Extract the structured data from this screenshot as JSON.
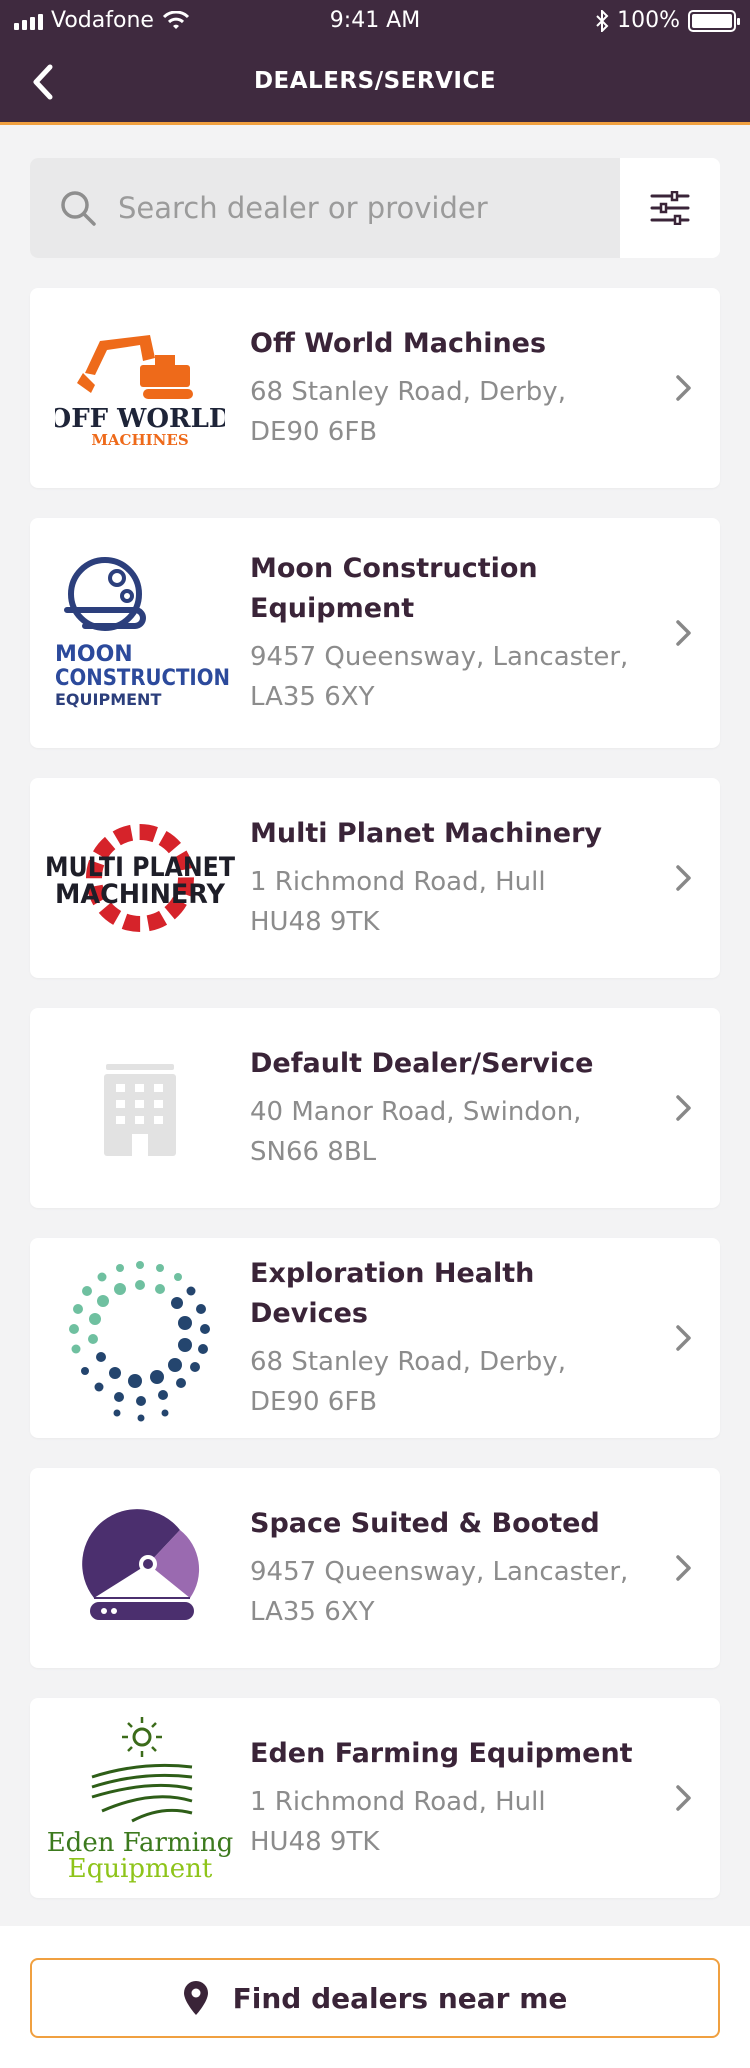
{
  "status": {
    "carrier": "Vodafone",
    "time": "9:41 AM",
    "battery": "100%"
  },
  "header": {
    "title": "DEALERS/SERVICE"
  },
  "search": {
    "placeholder": "Search dealer or provider"
  },
  "colors": {
    "header_bg": "#3f2a3f",
    "accent": "#f0a040",
    "title_text": "#3a2438"
  },
  "dealers": [
    {
      "name": "Off World Machines",
      "address_line1": "68 Stanley Road, Derby,",
      "address_line2": "DE90 6FB",
      "logo": "off-world-machines-logo",
      "logo_text1": "OFF WORLD",
      "logo_text2": "MACHINES"
    },
    {
      "name": "Moon Construction Equipment",
      "address_line1": "9457 Queensway, Lancaster,",
      "address_line2": "LA35 6XY",
      "logo": "moon-construction-logo",
      "logo_text1": "MOON",
      "logo_text2": "CONSTRUCTION",
      "logo_text3": "EQUIPMENT"
    },
    {
      "name": "Multi Planet Machinery",
      "address_line1": "1 Richmond Road, Hull",
      "address_line2": "HU48 9TK",
      "logo": "multi-planet-logo",
      "logo_text1": "MULTI PLANET",
      "logo_text2": "MACHINERY"
    },
    {
      "name": "Default Dealer/Service",
      "address_line1": "40 Manor Road, Swindon,",
      "address_line2": "SN66 8BL",
      "logo": "building-icon"
    },
    {
      "name": "Exploration Health Devices",
      "address_line1": "68 Stanley Road, Derby,",
      "address_line2": "DE90 6FB",
      "logo": "dot-ring-logo"
    },
    {
      "name": "Space Suited & Booted",
      "address_line1": "9457 Queensway, Lancaster,",
      "address_line2": "LA35 6XY",
      "logo": "helmet-logo"
    },
    {
      "name": "Eden Farming Equipment",
      "address_line1": "1 Richmond Road, Hull",
      "address_line2": "HU48 9TK",
      "logo": "eden-farming-logo",
      "logo_text1": "Eden Farming",
      "logo_text2": "Equipment"
    }
  ],
  "footer": {
    "find_label": "Find dealers near me"
  }
}
